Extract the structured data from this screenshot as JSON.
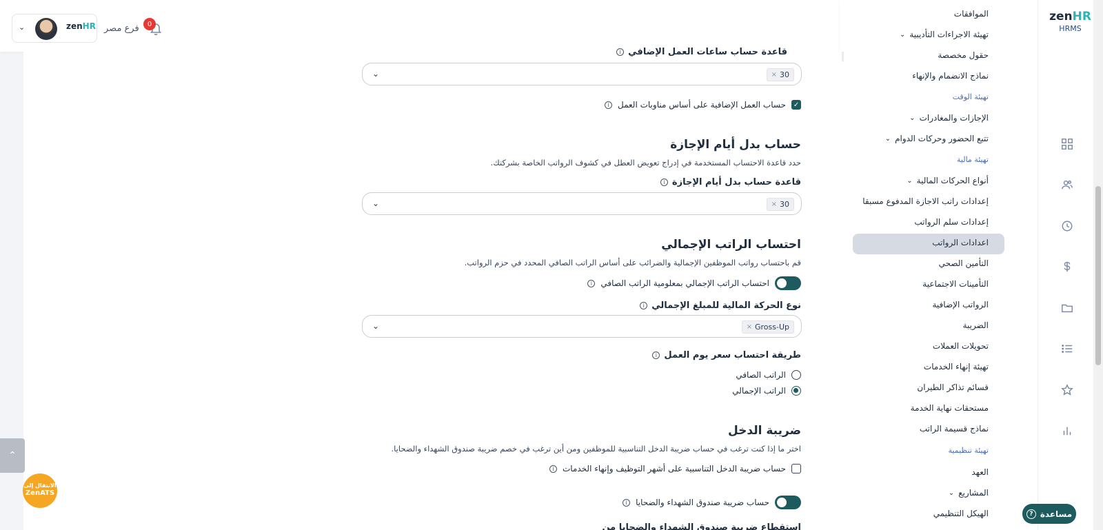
{
  "app": {
    "brand_main": "zen",
    "brand_accent": "HR",
    "brand_sub": "HRMS"
  },
  "header": {
    "branch": "فرع مصر",
    "notification_count": "0",
    "mini_logo_main": "zen",
    "mini_logo_accent": "HR"
  },
  "nav": {
    "items": [
      {
        "label": "الموافقات",
        "type": "item"
      },
      {
        "label": "تهيئة الاجراءات التأديبية",
        "type": "item",
        "chevron": true
      },
      {
        "label": "حقول مخصصة",
        "type": "item"
      },
      {
        "label": "نماذج الانضمام والإنهاء",
        "type": "item"
      },
      {
        "label": "تهيئة الوقت",
        "type": "section"
      },
      {
        "label": "الإجازات والمغادرات",
        "type": "item",
        "chevron": true
      },
      {
        "label": "تتبع الحضور وحركات الدوام",
        "type": "item",
        "chevron": true
      },
      {
        "label": "تهيئة مالية",
        "type": "section"
      },
      {
        "label": "أنواع الحركات المالية",
        "type": "item",
        "chevron": true
      },
      {
        "label": "إعدادات راتب الاجازة المدفوع مسبقا",
        "type": "item"
      },
      {
        "label": "إعدادات سلم الرواتب",
        "type": "item"
      },
      {
        "label": "اعدادات الرواتب",
        "type": "item",
        "active": true
      },
      {
        "label": "التأمين الصحي",
        "type": "item"
      },
      {
        "label": "التأمينات الاجتماعية",
        "type": "item"
      },
      {
        "label": "الرواتب الإضافية",
        "type": "item"
      },
      {
        "label": "الضريبة",
        "type": "item"
      },
      {
        "label": "تحويلات العملات",
        "type": "item"
      },
      {
        "label": "تهيئة إنهاء الخدمات",
        "type": "item"
      },
      {
        "label": "قسائم تذاكر الطيران",
        "type": "item"
      },
      {
        "label": "مستحقات نهاية الخدمة",
        "type": "item"
      },
      {
        "label": "نماذج قسيمة الراتب",
        "type": "item"
      },
      {
        "label": "تهيئة تنظيمية",
        "type": "section"
      },
      {
        "label": "العهد",
        "type": "item"
      },
      {
        "label": "المشاريع",
        "type": "item",
        "chevron": true
      },
      {
        "label": "الهيكل التنظيمي",
        "type": "item"
      }
    ]
  },
  "main": {
    "overtime_basis_label": "قاعدة حساب ساعات العمل الإضافي",
    "overtime_basis_value": "30",
    "overtime_shift_check": "حساب العمل الإضافية على أساس مناوبات العمل",
    "leave_allowance": {
      "title": "حساب بدل أيام الإجازة",
      "desc": "حدد قاعدة الاحتساب المستخدمة في إدراج تعويض العطل في كشوف الرواتب الخاصة بشركتك.",
      "basis_label": "قاعدة حساب بدل أيام الإجازة",
      "basis_value": "30"
    },
    "gross_salary": {
      "title": "احتساب الراتب الإجمالي",
      "desc": "قم باحتساب رواتب الموظفين الإجمالية والضرائب على أساس الراتب الصافي المحدد في حزم الرواتب.",
      "toggle_label": "احتساب الراتب الإجمالي بمعلومية الراتب الصافي",
      "txn_type_label": "نوع الحركة المالية للمبلغ الإجمالي",
      "txn_type_value": "Gross-Up",
      "daily_rate_label": "طريقة احتساب سعر يوم العمل",
      "radio_net": "الراتب الصافي",
      "radio_gross": "الراتب الإجمالي"
    },
    "income_tax": {
      "title": "ضريبة الدخل",
      "desc": "اختر ما إذا كنت ترغب في حساب ضريبة الدخل التناسبية للموظفين ومن أين ترغب في خصم ضريبة صندوق الشهداء والضحايا.",
      "prorate_check": "حساب ضريبة الدخل التناسبية على أشهر التوظيف وإنهاء الخدمات",
      "martyrs_toggle": "حساب ضريبة صندوق الشهداء والضحايا",
      "cut_heading": "استقطاع ضريبة صندوق الشهداء والضحايا من"
    }
  },
  "floating": {
    "zenats_line1": "الانتقال إلى",
    "zenats_line2": "ZenATS",
    "help_label": "مساعدة"
  },
  "colors": {
    "accent": "#1e5b5e",
    "brand_hr": "#2bb3b8",
    "section": "#4a6cb3",
    "badge": "#e53935",
    "zenats": "#f5a623"
  }
}
